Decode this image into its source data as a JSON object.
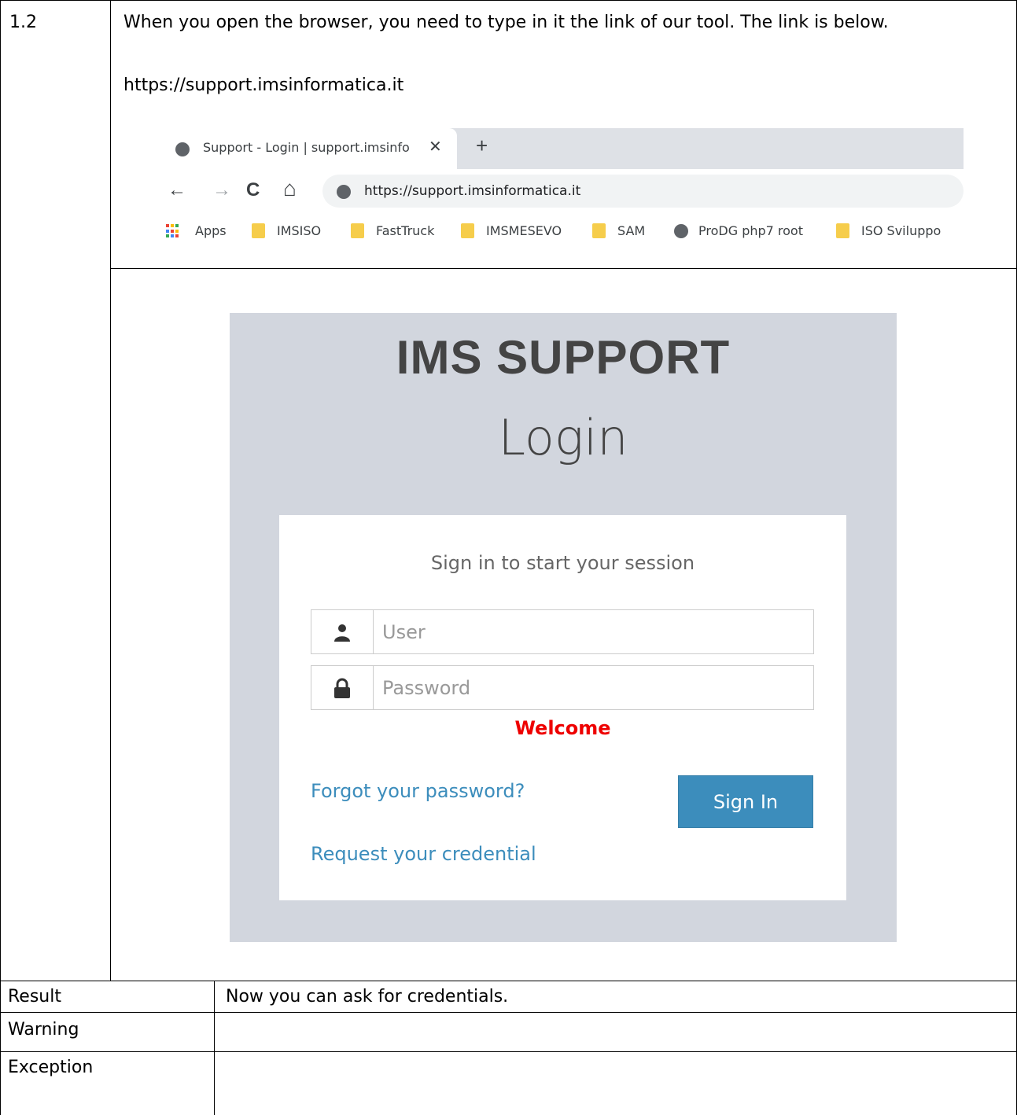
{
  "step": {
    "number": "1.2",
    "instruction": "When you open the browser, you need to type in it the link of our tool. The link is below.",
    "url": "https://support.imsinformatica.it"
  },
  "browser": {
    "tab_title": "Support - Login | support.imsinfo",
    "tab_close": "✕",
    "new_tab": "+",
    "nav": {
      "back": "←",
      "forward": "→",
      "reload": "C",
      "home": "⌂"
    },
    "address": "https://support.imsinformatica.it",
    "bookmarks": [
      {
        "label": "Apps",
        "icon": "apps-grid-icon"
      },
      {
        "label": "IMSISO",
        "icon": "folder-icon"
      },
      {
        "label": "FastTruck",
        "icon": "folder-icon"
      },
      {
        "label": "IMSMESEVO",
        "icon": "folder-icon"
      },
      {
        "label": "SAM",
        "icon": "folder-icon"
      },
      {
        "label": "ProDG php7 root",
        "icon": "globe-icon"
      },
      {
        "label": "ISO Sviluppo",
        "icon": "folder-icon"
      }
    ]
  },
  "login": {
    "brand": "IMS SUPPORT",
    "title": "Login",
    "session_message": "Sign in to start your session",
    "user_placeholder": "User",
    "password_placeholder": "Password",
    "welcome": "Welcome",
    "forgot_link": "Forgot your password?",
    "signin_button": "Sign In",
    "request_link": "Request your credential",
    "colors": {
      "panel_bg": "#d2d6de",
      "button": "#3c8dbc",
      "welcome": "#ee0000"
    }
  },
  "results": [
    {
      "label": "Result",
      "value": "Now you can ask for credentials."
    },
    {
      "label": "Warning",
      "value": ""
    },
    {
      "label": "Exception",
      "value": ""
    }
  ]
}
